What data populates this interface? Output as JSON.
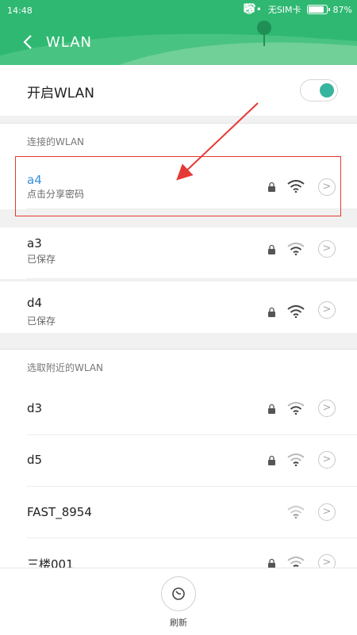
{
  "status_bar": {
    "time": "14:48",
    "dots": "•••",
    "sim": "无SIM卡",
    "battery": "87%",
    "battery_level": 0.87
  },
  "header": {
    "title": "WLAN"
  },
  "wlan_toggle": {
    "label": "开启WLAN",
    "on": true,
    "accent": "#37b39e"
  },
  "connected_section": {
    "title": "连接的WLAN"
  },
  "saved": [
    {
      "name": "a4",
      "sub": "点击分享密码",
      "name_color": "#3b8fdd",
      "locked": true,
      "signal": "strong"
    },
    {
      "name": "a3",
      "sub": "已保存",
      "locked": true,
      "signal": "medium"
    },
    {
      "name": "d4",
      "sub": "已保存",
      "locked": true,
      "signal": "strong"
    }
  ],
  "nearby_section": {
    "title": "选取附近的WLAN"
  },
  "nearby": [
    {
      "name": "d3",
      "locked": true,
      "signal": "medium"
    },
    {
      "name": "d5",
      "locked": true,
      "signal": "weak"
    },
    {
      "name": "FAST_8954",
      "locked": false,
      "signal": "weak"
    },
    {
      "name": "三楼001",
      "locked": true,
      "signal": "weak"
    }
  ],
  "icons": {
    "lock": "lock-icon",
    "wifi": "wifi-icon",
    "detail": "chevron-right-icon",
    "back": "back-arrow-icon",
    "refresh": "refresh-icon"
  },
  "bottom": {
    "refresh_label": "刷新"
  }
}
